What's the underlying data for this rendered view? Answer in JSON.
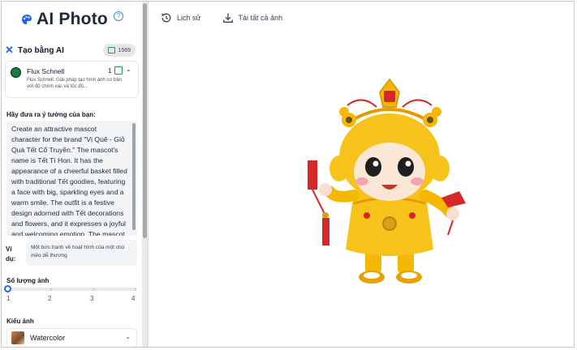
{
  "app": {
    "title": "AI Photo",
    "help_icon": "question-circle-icon"
  },
  "section": {
    "title": "Tạo bằng AI",
    "credits": "1569"
  },
  "model": {
    "name": "Flux Schnell",
    "count": "1",
    "description": "Flux Schnell: Giải pháp tạo hình ảnh cơ bản với độ chính xác và tốc độ..."
  },
  "prompt": {
    "label": "Hãy đưa ra ý tưởng của bạn:",
    "text": "Create an attractive mascot character for the brand \"Vị Quê - Giỏ Quà Tết Cổ Truyền.\" The mascot's name is Tết Tí Hon. It has the appearance of a cheerful basket filled with traditional Tết goodies, featuring a face with big, sparkling eyes and a warm smile. The outfit is a festive design adorned with Tết decorations and flowers, and it expresses a joyful and welcoming emotion. The mascot should stand"
  },
  "example": {
    "label": "Ví dụ:",
    "text": "Một bức tranh về hoạt hình của một chú mèo dễ thương"
  },
  "count": {
    "label": "Số lượng ảnh",
    "ticks": [
      "1",
      "2",
      "3",
      "4"
    ],
    "value": 1
  },
  "style": {
    "label": "Kiểu ảnh",
    "value": "Watercolor"
  },
  "toolbar": {
    "history": "Lịch sử",
    "download_all": "Tải tất cả ảnh"
  },
  "colors": {
    "accent": "#2563eb",
    "mascot_yellow": "#f5b800",
    "mascot_red": "#d62828"
  }
}
